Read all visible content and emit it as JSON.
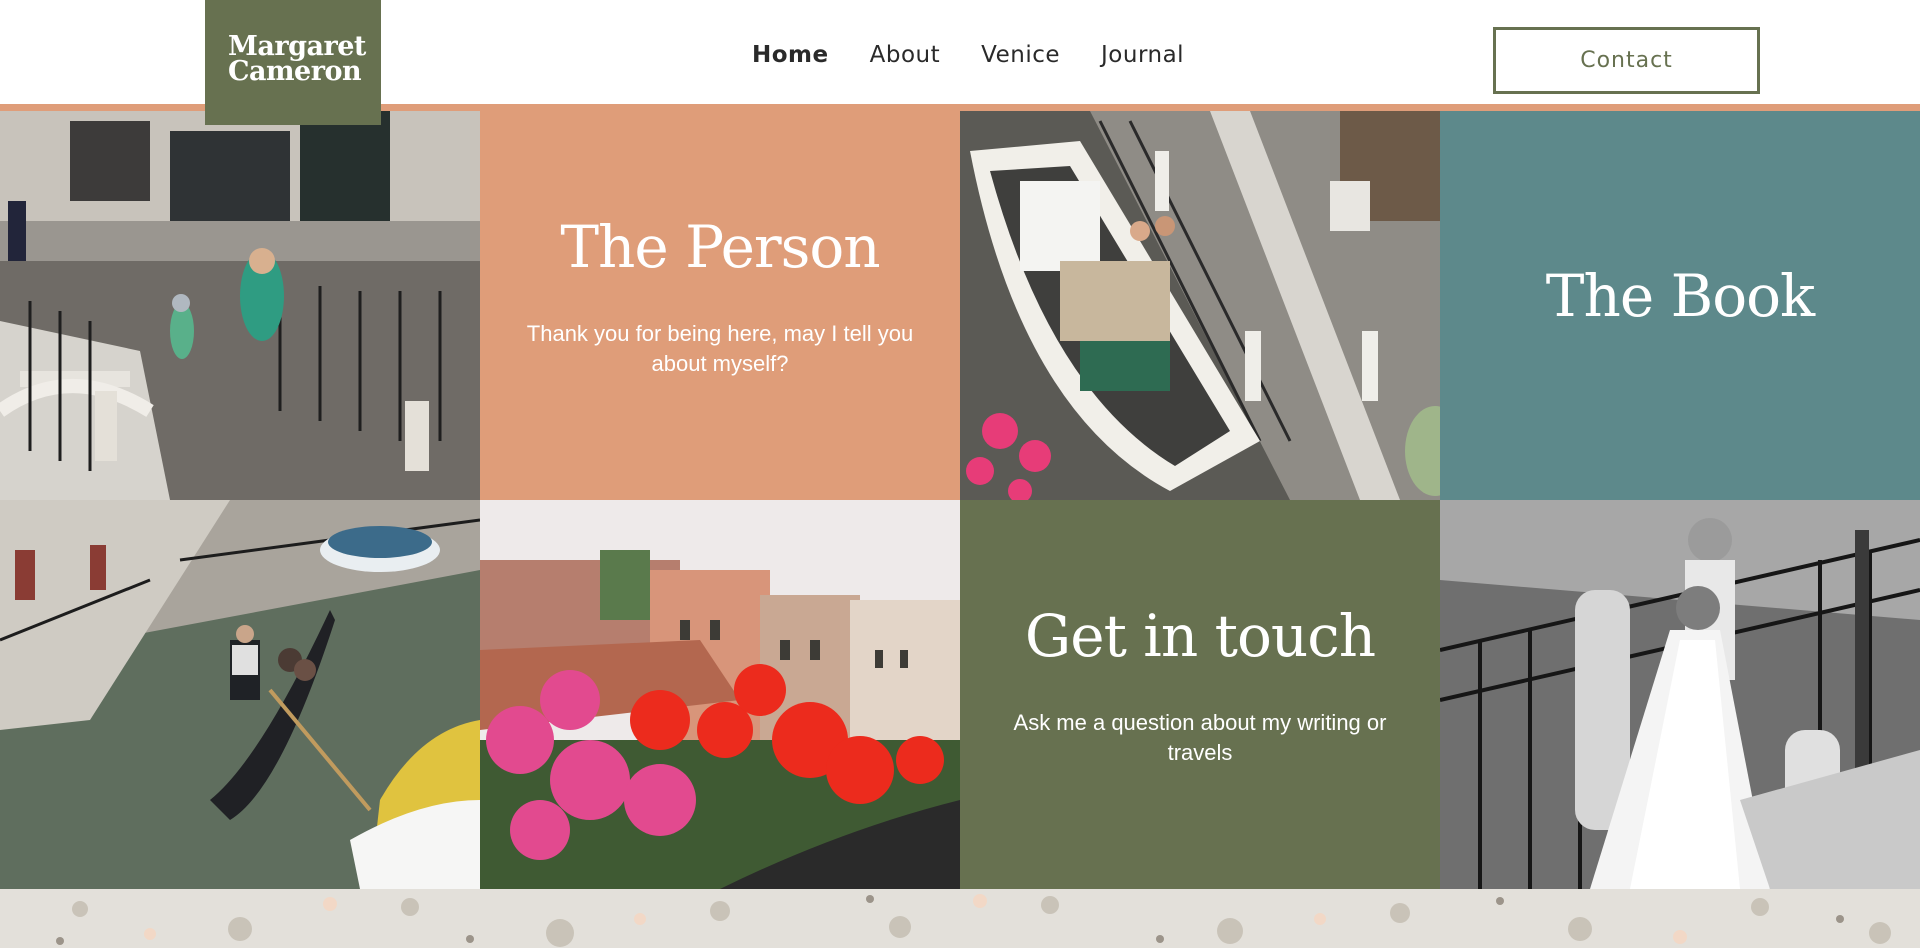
{
  "brand": {
    "line1": "Margaret",
    "line2": "Cameron",
    "color": "#677150"
  },
  "nav": [
    {
      "label": "Home",
      "active": true
    },
    {
      "label": "About",
      "active": false
    },
    {
      "label": "Venice",
      "active": false
    },
    {
      "label": "Journal",
      "active": false
    }
  ],
  "contact_button": {
    "label": "Contact"
  },
  "cards": {
    "person": {
      "title": "The Person",
      "text": "Thank you for being here, may I tell you about myself?",
      "color": "#df9d79"
    },
    "book": {
      "title": "The Book",
      "color": "#5d898b"
    },
    "touch": {
      "title": "Get in touch",
      "text": "Ask me a question about my writing or travels",
      "color": "#677150"
    }
  },
  "accent_rule_color": "#df9d79"
}
